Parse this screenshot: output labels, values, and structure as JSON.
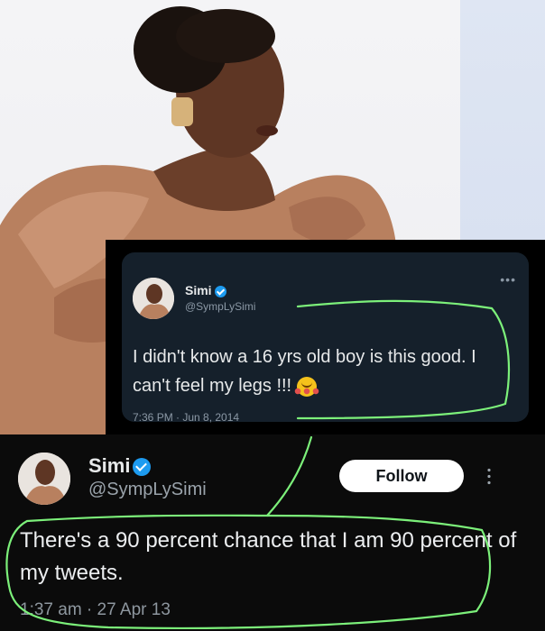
{
  "photo": {
    "subject": "woman-portrait"
  },
  "tweet_old": {
    "name": "Simi",
    "handle": "@SympLySimi",
    "more": "•••",
    "text": "I didn't know a 16 yrs old boy is this good. I can't feel my legs !!!",
    "timestamp": "7:36 PM · Jun 8, 2014"
  },
  "tweet_new": {
    "name": "Simi",
    "handle": "@SympLySimi",
    "follow_label": "Follow",
    "text": "There's a 90 percent chance that I am 90 percent of my tweets.",
    "timestamp": "1:37 am · 27 Apr 13"
  },
  "colors": {
    "verified": "#1d9bf0",
    "annotation": "#7cf07a",
    "card_dark": "#15202b"
  }
}
